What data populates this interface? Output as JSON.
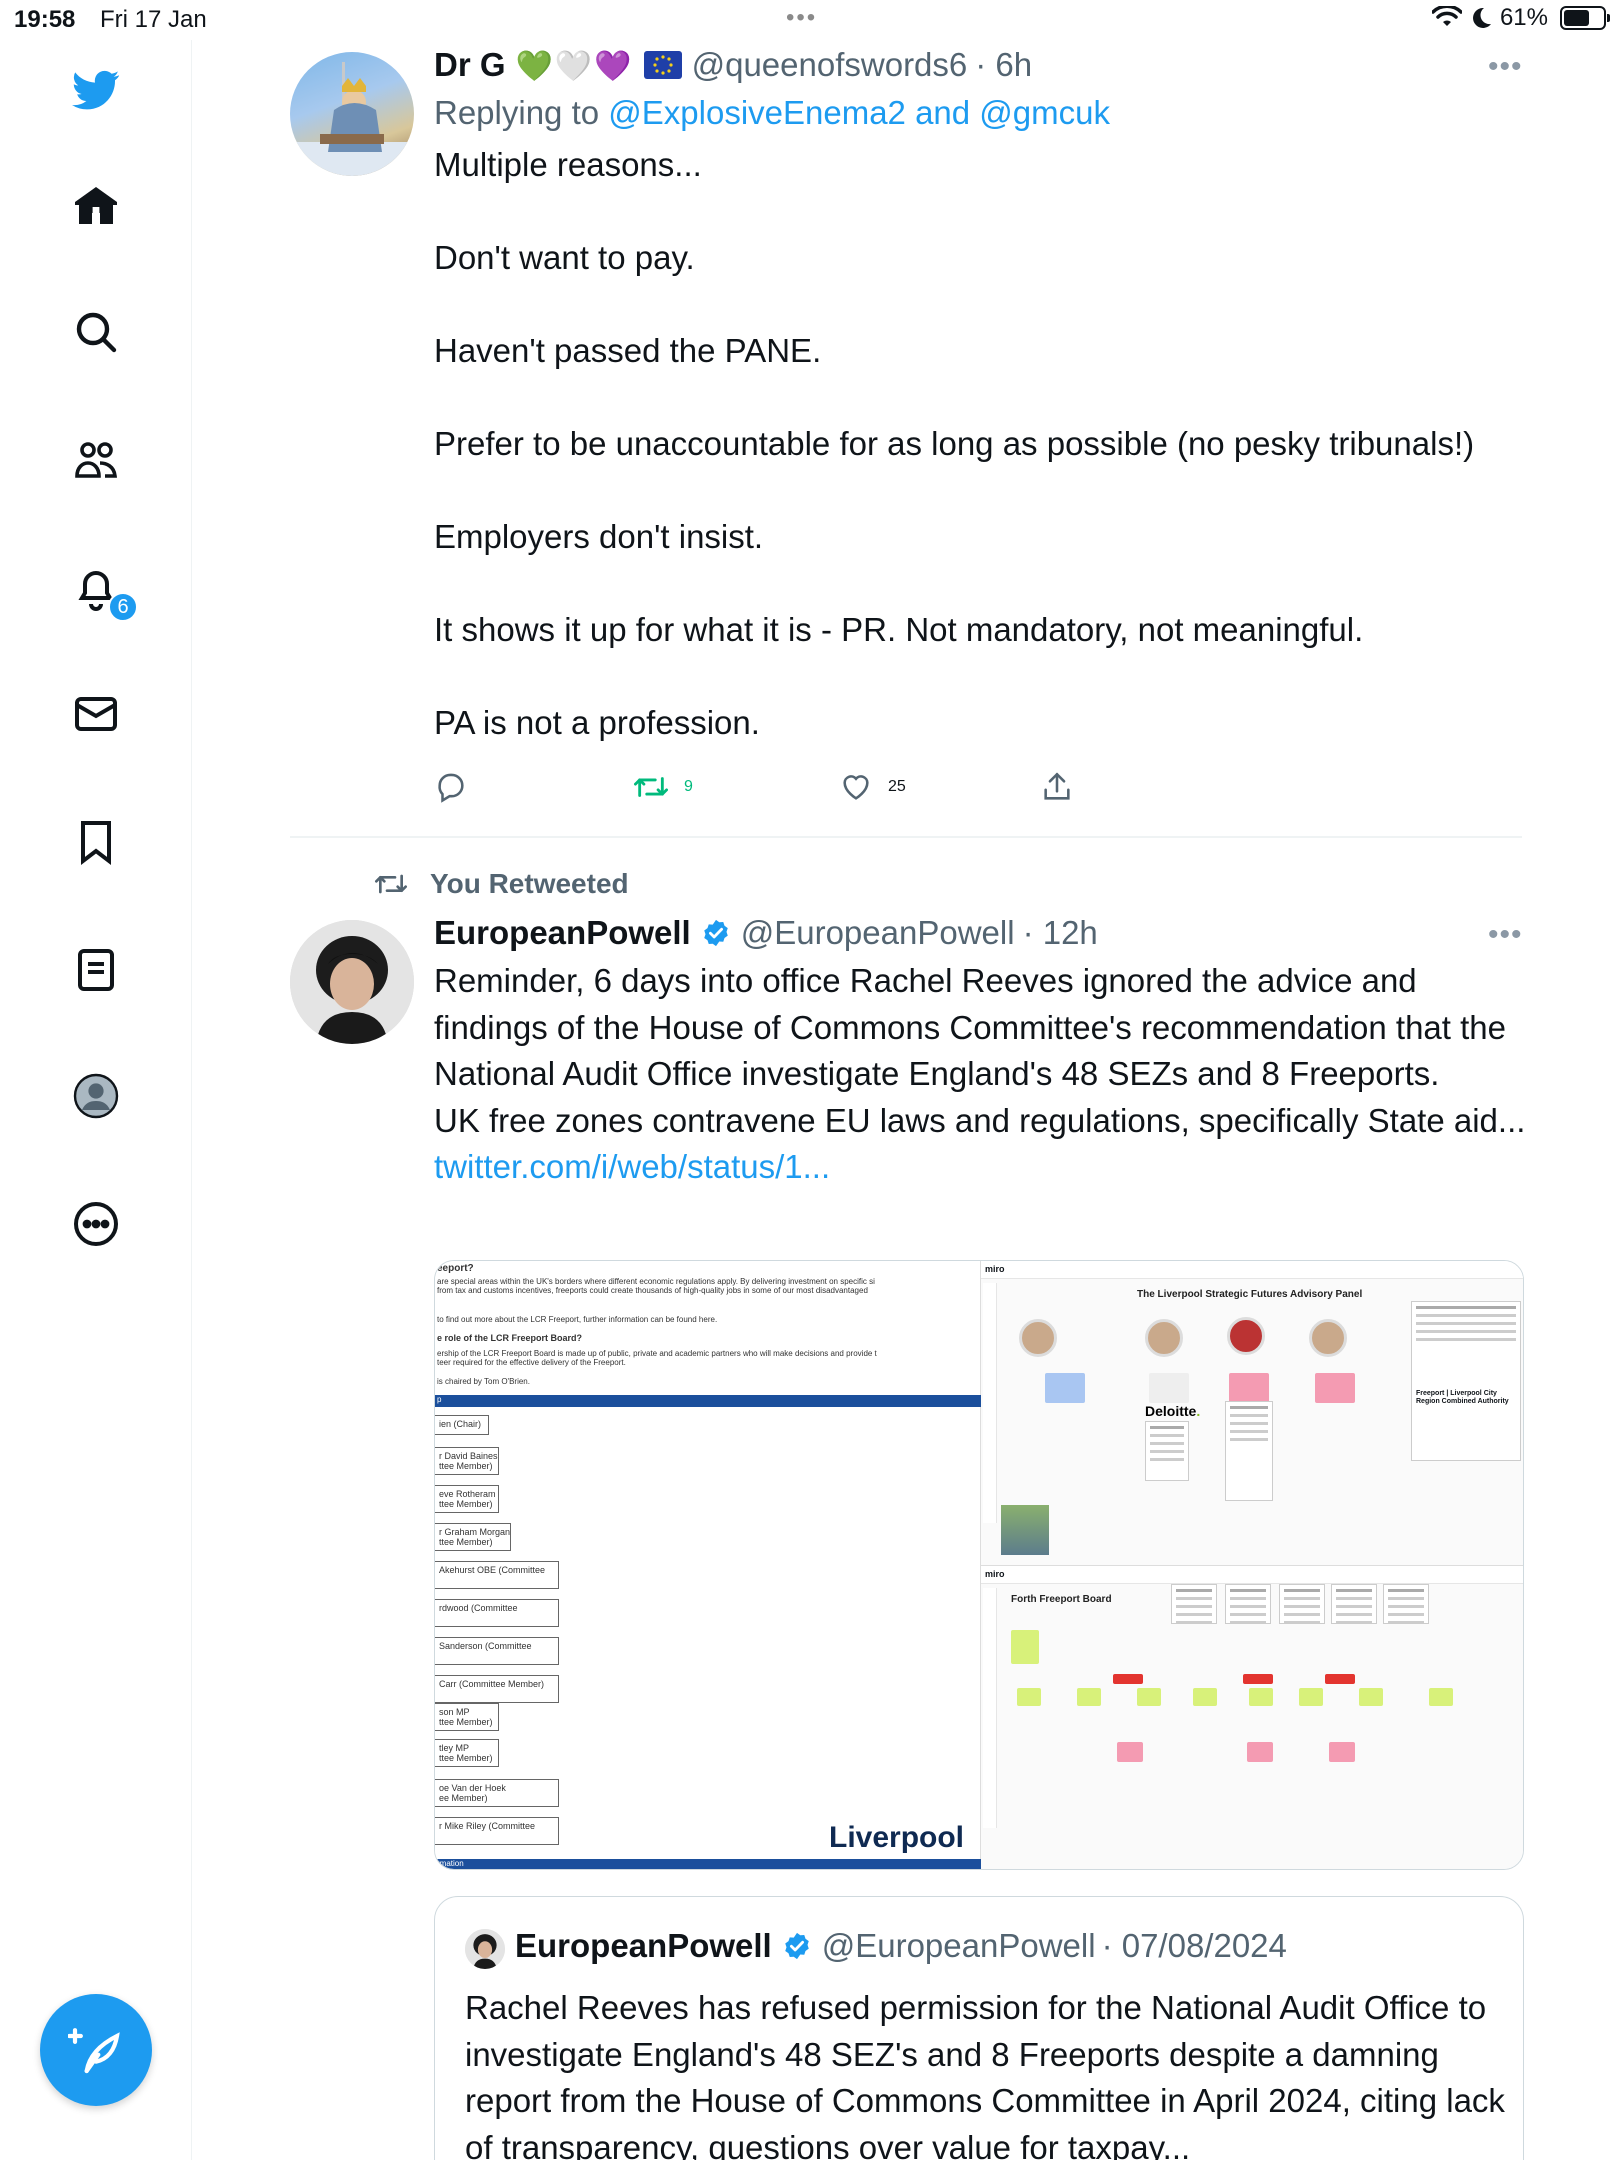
{
  "status_bar": {
    "time": "19:58",
    "date": "Fri 17 Jan",
    "battery": "61%"
  },
  "sidebar": {
    "items": [
      {
        "name": "twitter-logo"
      },
      {
        "name": "home"
      },
      {
        "name": "explore"
      },
      {
        "name": "communities"
      },
      {
        "name": "notifications",
        "badge": "6"
      },
      {
        "name": "messages"
      },
      {
        "name": "bookmarks"
      },
      {
        "name": "lists"
      },
      {
        "name": "profile"
      },
      {
        "name": "more"
      }
    ],
    "compose_label": "Tweet"
  },
  "tweets": [
    {
      "author": "Dr G",
      "handle": "@queenofswords6",
      "time": "· 6h",
      "name_emojis": [
        "💚",
        "🤍",
        "💜"
      ],
      "reply_prefix": "Replying to ",
      "reply_targets": "@ExplosiveEnema2 and @gmcuk",
      "text": "Multiple reasons...\n\nDon't want to pay.\n\nHaven't passed the PANE.\n\nPrefer to be unaccountable for as long as possible (no pesky tribunals!)\n\nEmployers don't insist.\n\nIt shows it up for what it is - PR. Not mandatory, not meaningful.\n\nPA is not a profession.",
      "retweets": "9",
      "likes": "25",
      "colors": {
        "retweet_active": "#00ba7c"
      }
    },
    {
      "social_context": "You Retweeted",
      "author": "EuropeanPowell",
      "handle": "@EuropeanPowell",
      "time": "· 12h",
      "text_main": "Reminder, 6 days into office Rachel Reeves ignored the advice and findings of the House of Commons Committee's recommendation that the National Audit Office investigate England's 48 SEZs and 8 Freeports.\nUK free zones contravene EU laws and regulations, specifically State aid... ",
      "text_link": "twitter.com/i/web/status/1...",
      "media": {
        "doc_brand": "Liverpool",
        "miro_label": "miro",
        "miro_board_1": "The Liverpool Strategic Futures Advisory Panel",
        "miro_board_2": "Forth Freeport Board",
        "deloitte": "Deloitte",
        "sidebar_card_title": "Freeport | Liverpool City Region Combined Authority",
        "doc_lines": [
          "eeport?",
          "are special areas within the UK's borders where different economic regulations apply. By delivering investment on specific si",
          "from tax and customs incentives, freeports could create thousands of high-quality jobs in some of our most disadvantaged",
          "to find out more about the LCR Freeport, further information can be found here.",
          "e role of the LCR Freeport Board?",
          "ership of the LCR Freeport Board is made up of public, private and academic partners who will make decisions and provide t",
          "teer required for the effective delivery of the Freeport.",
          "is chaired by Tom O'Brien."
        ],
        "doc_boxes": [
          "ien  (Chair)",
          "r David Baines\nttee Member)",
          "eve Rotheram\nttee Member)",
          "r Graham Morgan\nttee Member)",
          "Akehurst OBE  (Committee",
          "rdwood  (Committee",
          "Sanderson  (Committee",
          "Carr  (Committee Member)",
          "son MP\nttee Member)",
          "tley MP\nttee Member)",
          "oe Van der Hoek\nee Member)",
          "r Mike Riley  (Committee"
        ],
        "doc_section_label": "p",
        "doc_footer_label": "rmation"
      },
      "quote": {
        "author": "EuropeanPowell",
        "handle": "@EuropeanPowell",
        "date": "· 07/08/2024",
        "text": "Rachel Reeves has refused permission for the National Audit Office to investigate England's 48 SEZ's and 8 Freeports despite a damning report from the House of Commons Committee in April 2024, citing lack of transparency, questions over value for taxpay..."
      }
    }
  ],
  "colors": {
    "accent": "#1d9bf0",
    "text": "#0f1419",
    "secondary": "#536471",
    "verified": "#1d9bf0"
  }
}
